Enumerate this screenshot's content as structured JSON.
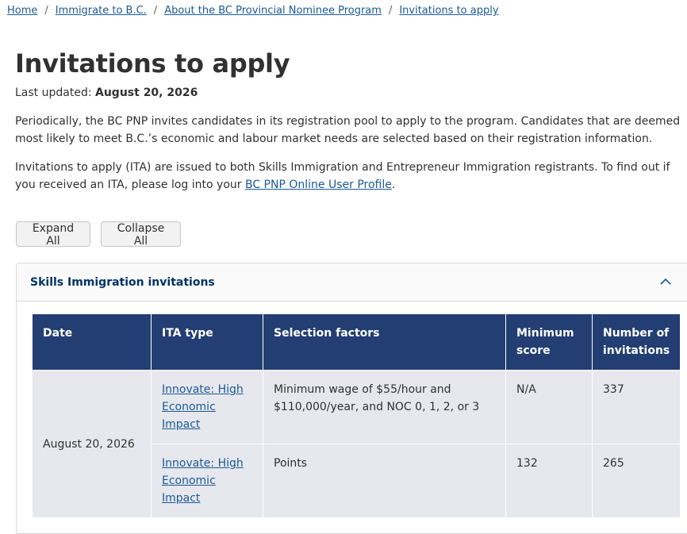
{
  "breadcrumb": {
    "items": [
      "Home",
      "Immigrate to B.C.",
      "About the BC Provincial Nominee Program",
      "Invitations to apply"
    ],
    "separator": "/"
  },
  "page": {
    "title": "Invitations to apply",
    "updated_label": "Last updated:",
    "updated_date": "August 20, 2026",
    "para1": "Periodically, the BC PNP invites candidates in its registration pool to apply to the program. Candidates that are deemed most likely to meet B.C.’s economic and labour market needs are selected based on their registration information.",
    "para2_before": "Invitations to apply (ITA) are issued to both Skills Immigration and Entrepreneur Immigration registrants. To find out if you received an ITA, please log into your ",
    "para2_link": "BC PNP Online User Profile",
    "para2_after": "."
  },
  "buttons": {
    "expand_all": "Expand All",
    "collapse_all": "Collapse All"
  },
  "accordion": {
    "title": "Skills Immigration invitations",
    "table": {
      "headers": [
        "Date",
        "ITA type",
        "Selection factors",
        "Minimum score",
        "Number of invitations"
      ],
      "date": "August 20, 2026",
      "rows": [
        {
          "ita_type": "Innovate: High Economic Impact",
          "factors": "Minimum wage of $55/hour and $110,000/year, and NOC 0, 1, 2, or 3",
          "min_score": "N/A",
          "invitations": "337"
        },
        {
          "ita_type": "Innovate: High Economic Impact",
          "factors": "Points",
          "min_score": "132",
          "invitations": "265"
        }
      ]
    }
  },
  "colors": {
    "link": "#1a5a96",
    "table_header_bg": "#223e72",
    "table_cell_bg": "#e7e8ed",
    "accordion_title": "#003366"
  },
  "icons": {
    "accordion_toggle": "chevron-up-icon"
  }
}
